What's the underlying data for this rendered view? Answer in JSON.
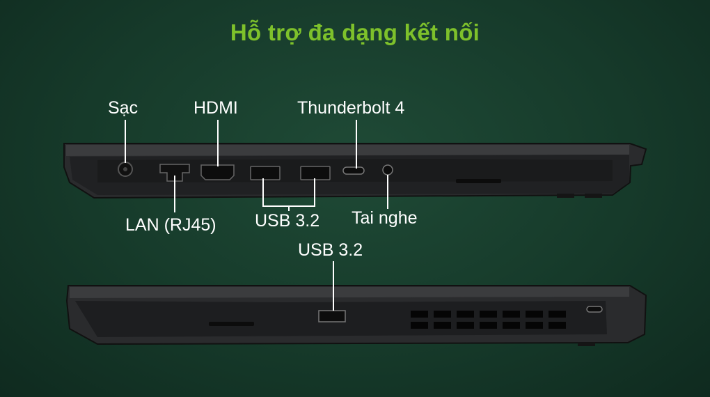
{
  "title": "Hỗ trợ đa dạng kết nối",
  "labels": {
    "sac": "Sạc",
    "hdmi": "HDMI",
    "thunderbolt": "Thunderbolt 4",
    "lan": "LAN (RJ45)",
    "usb_left_1": "USB 3.2",
    "tai_nghe": "Tai nghe",
    "usb_right": "USB 3.2"
  },
  "colors": {
    "title": "#7ec12b",
    "label": "#ffffff",
    "background": "#163a2a"
  }
}
